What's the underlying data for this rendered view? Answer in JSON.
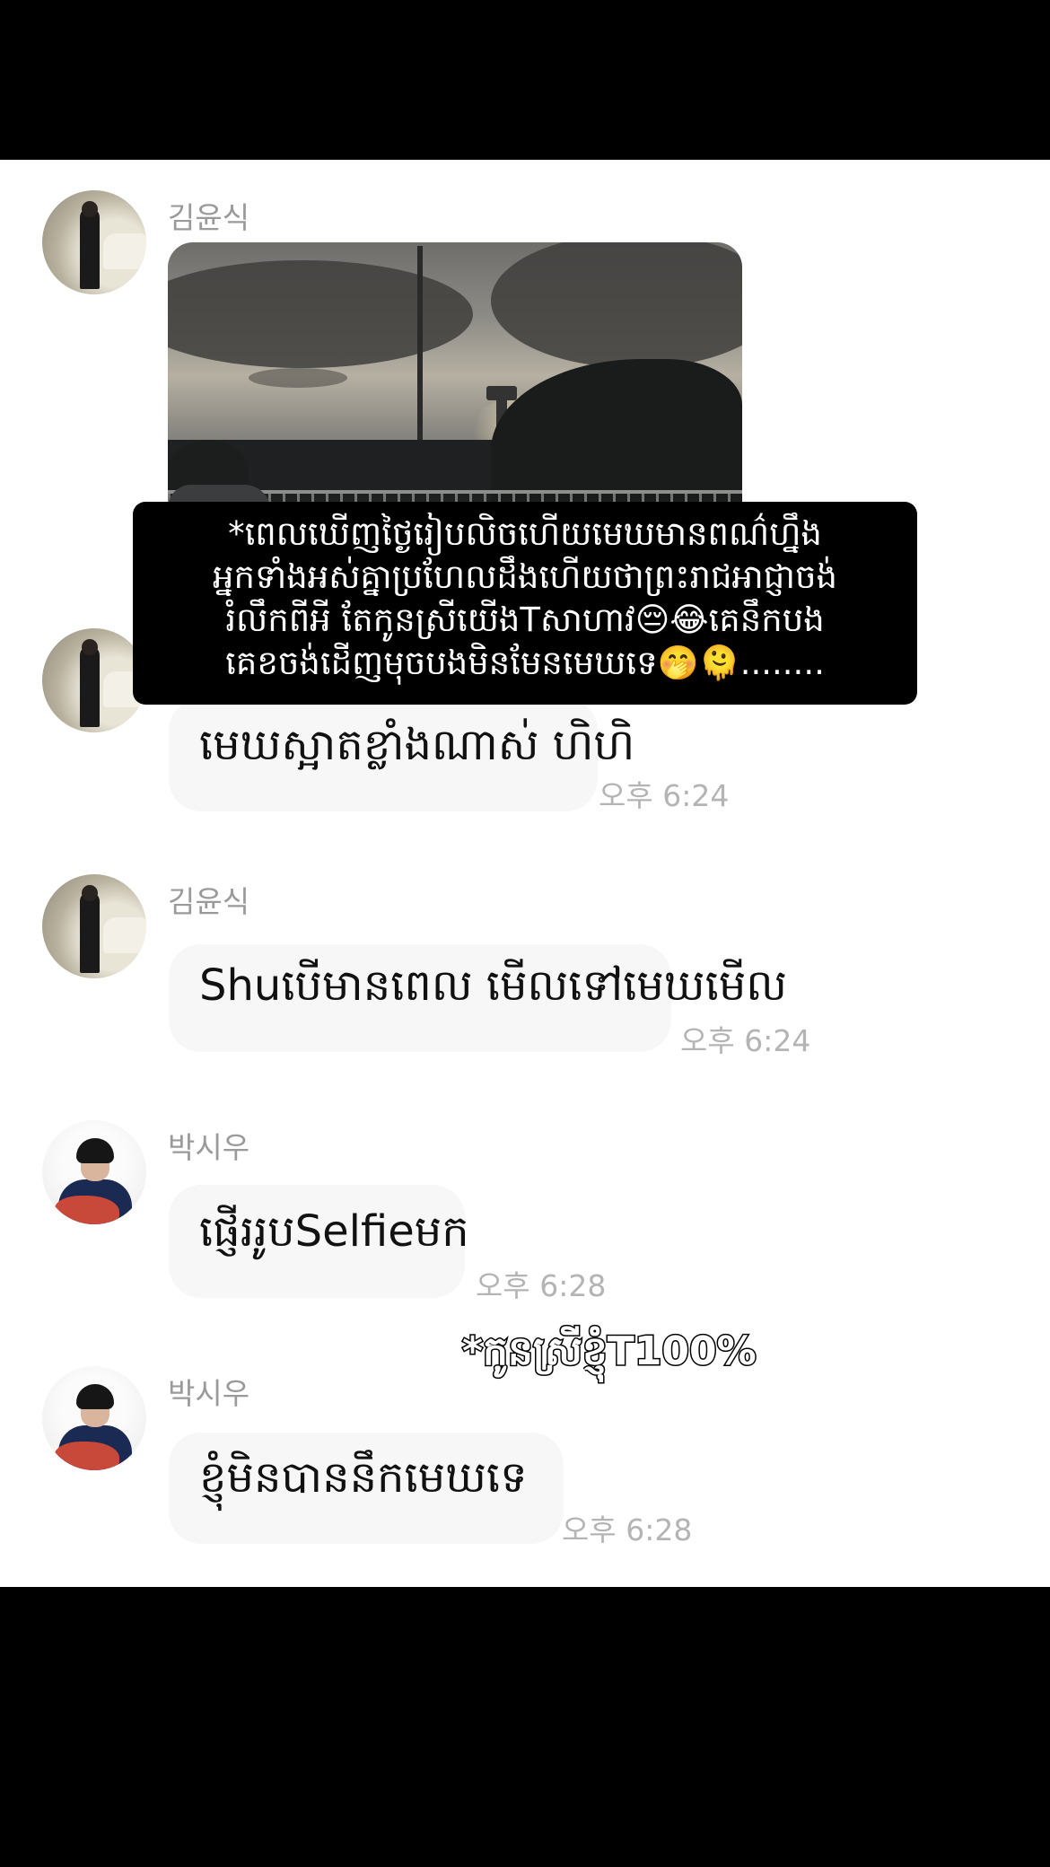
{
  "messages": [
    {
      "sender": "김윤식",
      "kind": "photo"
    },
    {
      "text": "មេឃស្អាតខ្លាំងណាស់ ហិហិ",
      "time": "오후 6:24"
    },
    {
      "sender": "김윤식",
      "text": "Shuបើមានពេល មើលទៅមេឃមើល",
      "time": "오후 6:24"
    },
    {
      "sender": "박시우",
      "text": "ផ្ញើររូបSelfieមក",
      "time": "오후 6:28"
    },
    {
      "sender": "박시우",
      "text": "ខ្ញុំមិនបាននឹកមេឃទេ",
      "time": "오후 6:28"
    }
  ],
  "overlay": {
    "text": "*ពេលឃើញថ្ងៃរៀបលិចហើយមេឃមានពណ៌ហ្នឹង\nអ្នកទាំងអស់គ្នាប្រហែលដឹងហើយថាព្រះរាជអាជ្ញាចង់\nរំលឹកពីអី តែកូនស្រីយើងTសាហាវ😔😂គេនឹកបង\nគេខចង់ដើញមុចបងមិនមែនមេឃទេ🤭🫠........"
  },
  "caption": "*កូនស្រីខ្ញុំT100%"
}
